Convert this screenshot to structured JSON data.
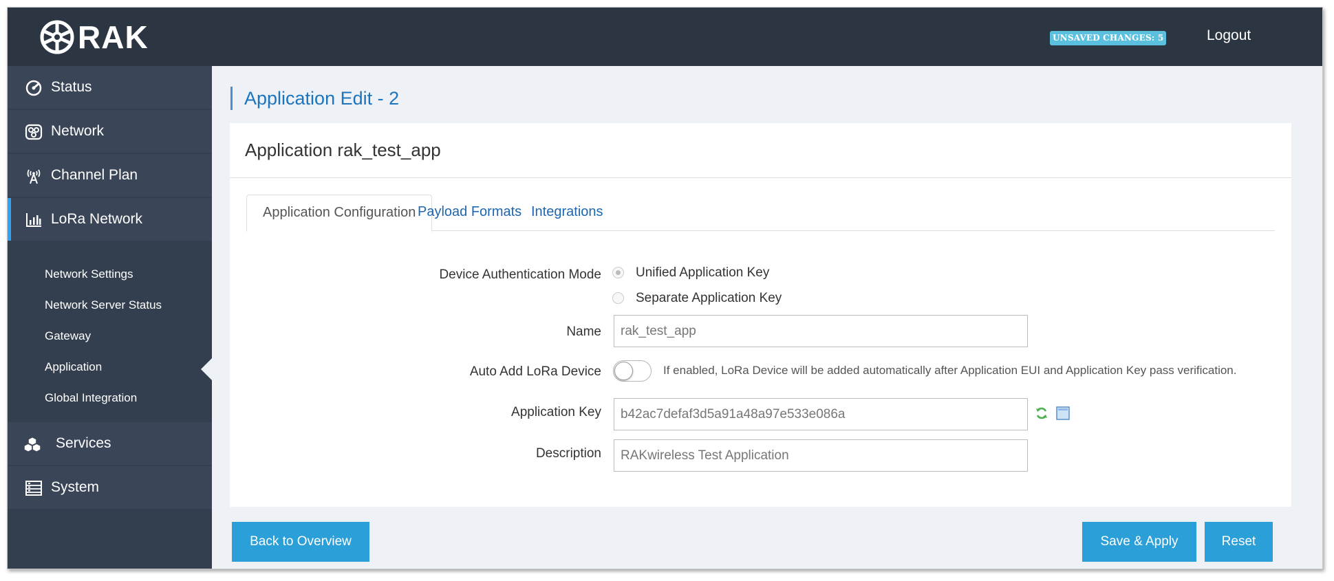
{
  "header": {
    "brand": "RAK",
    "unsaved_badge": "UNSAVED CHANGES: 5",
    "logout": "Logout"
  },
  "sidebar": {
    "items": [
      {
        "label": "Status",
        "icon": "dashboard-icon"
      },
      {
        "label": "Network",
        "icon": "network-icon"
      },
      {
        "label": "Channel Plan",
        "icon": "antenna-icon"
      },
      {
        "label": "LoRa Network",
        "icon": "bar-chart-icon",
        "active": true
      },
      {
        "label": "Services",
        "icon": "cubes-icon"
      },
      {
        "label": "System",
        "icon": "server-list-icon"
      }
    ],
    "submenu": [
      "Network Settings",
      "Network Server Status",
      "Gateway",
      "Application",
      "Global Integration"
    ],
    "active_submenu": "Application"
  },
  "main": {
    "page_title": "Application Edit - 2",
    "card_title": "Application rak_test_app",
    "tabs": [
      {
        "label": "Application Configuration",
        "active": true
      },
      {
        "label": "Payload Formats",
        "active": false
      },
      {
        "label": "Integrations",
        "active": false
      }
    ],
    "form": {
      "auth_mode_label": "Device Authentication Mode",
      "auth_options": [
        "Unified Application Key",
        "Separate Application Key"
      ],
      "auth_selected": "Unified Application Key",
      "name_label": "Name",
      "name_value": "rak_test_app",
      "auto_add_label": "Auto Add LoRa Device",
      "auto_add_enabled": false,
      "auto_add_help": "If enabled, LoRa Device will be added automatically after Application EUI and Application Key pass verification.",
      "app_key_label": "Application Key",
      "app_key_value": "b42ac7defaf3d5a91a48a97e533e086a",
      "description_label": "Description",
      "description_value": "RAKwireless Test Application"
    },
    "buttons": {
      "back": "Back to Overview",
      "save": "Save & Apply",
      "reset": "Reset"
    }
  },
  "colors": {
    "topbar": "#2c3642",
    "sidebar": "#333f4f",
    "accent": "#2a9fd8",
    "badge": "#5bc0de"
  }
}
